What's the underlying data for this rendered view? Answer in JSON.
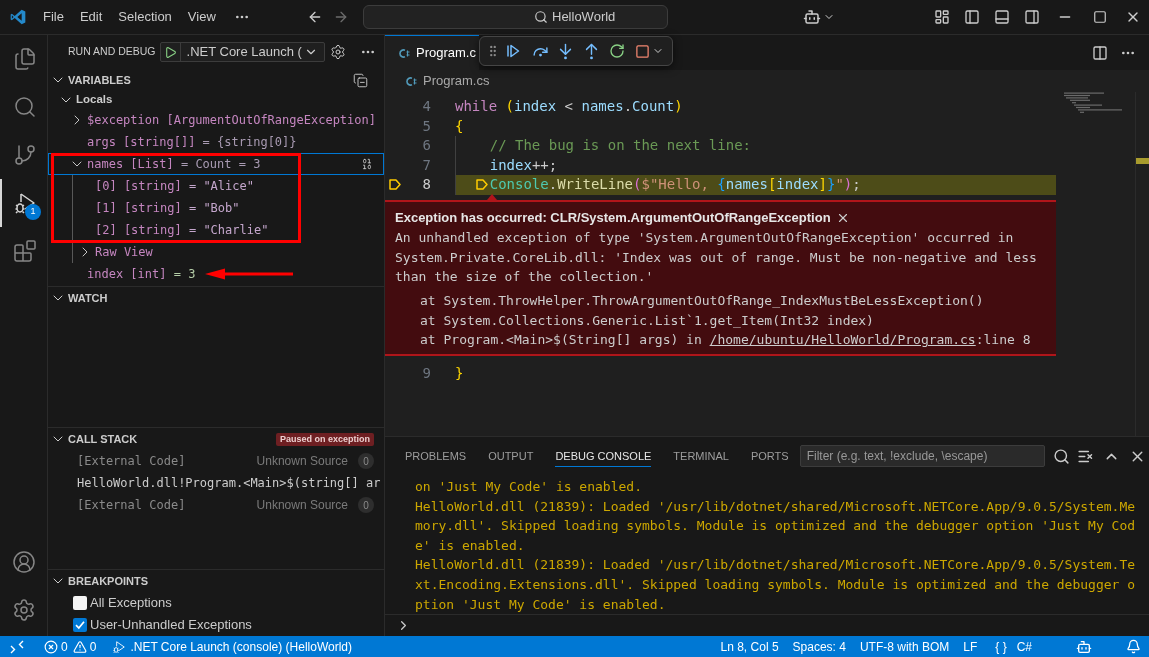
{
  "title_bar": {
    "menu": [
      {
        "label": "File"
      },
      {
        "label": "Edit"
      },
      {
        "label": "Selection"
      },
      {
        "label": "View"
      }
    ],
    "command_center": "HelloWorld"
  },
  "activity_bar": {
    "items": [
      {
        "kind": "explorer",
        "selected": false
      },
      {
        "kind": "search",
        "selected": false
      },
      {
        "kind": "source_control",
        "selected": false
      },
      {
        "kind": "run_debug",
        "selected": true,
        "badge": "1"
      },
      {
        "kind": "extensions",
        "selected": false
      }
    ],
    "bottom": [
      {
        "kind": "accounts"
      },
      {
        "kind": "manage"
      }
    ]
  },
  "sidebar": {
    "title": "RUN AND DEBUG",
    "launch_config": ".NET Core Launch (",
    "variables": {
      "title": "VARIABLES",
      "expanded": true,
      "scopes": [
        {
          "label": "Locals",
          "expanded": true,
          "children": [
            {
              "name": "$exception [ArgumentOutOfRangeException]",
              "expanded": false,
              "selected": false,
              "framed": false,
              "pointed": false
            },
            {
              "name": "args [string[]]",
              "value": "= {string[0]}",
              "kind": "plain",
              "selected": false,
              "framed": false,
              "pointed": false
            },
            {
              "name": "names [List]",
              "value": "= Count = 3",
              "kind": "plain",
              "expanded": true,
              "selected": true,
              "framed": true,
              "pointed": false,
              "children": [
                {
                  "name": "[0] [string]",
                  "value": "= \"Alice\"",
                  "kind": "string",
                  "selected": false,
                  "framed": false,
                  "pointed": false
                },
                {
                  "name": "[1] [string]",
                  "value": "= \"Bob\"",
                  "kind": "string",
                  "selected": false,
                  "framed": false,
                  "pointed": false
                },
                {
                  "name": "[2] [string]",
                  "value": "= \"Charlie\"",
                  "kind": "string",
                  "selected": false,
                  "framed": false,
                  "pointed": false
                },
                {
                  "name": "Raw View",
                  "expanded": false,
                  "selected": false,
                  "framed": false,
                  "pointed": false
                }
              ]
            },
            {
              "name": "index [int]",
              "value": "= 3",
              "kind": "number",
              "selected": false,
              "framed": false,
              "pointed": true
            }
          ]
        }
      ]
    },
    "watch": {
      "title": "WATCH",
      "expanded": true
    },
    "call_stack": {
      "title": "CALL STACK",
      "expanded": true,
      "badge": "Paused on exception",
      "frames": [
        {
          "kind": "external",
          "name": "[External Code]",
          "source": "Unknown Source",
          "count": "0"
        },
        {
          "kind": "frame",
          "name": "HelloWorld.dll!Program.<Main>$(string[] ar"
        },
        {
          "kind": "external",
          "name": "[External Code]",
          "source": "Unknown Source",
          "count": "0"
        }
      ]
    },
    "breakpoints": {
      "title": "BREAKPOINTS",
      "expanded": true,
      "items": [
        {
          "label": "All Exceptions",
          "checked": false
        },
        {
          "label": "User-Unhandled Exceptions",
          "checked": true
        }
      ]
    }
  },
  "editor": {
    "tabs": [
      {
        "label": "Program.c",
        "selected": true
      }
    ],
    "breadcrumb": "Program.cs",
    "lines": [
      {
        "number": "4",
        "current": false,
        "tokens": [
          {
            "text": "while",
            "kind": "keyword"
          },
          {
            "text": " (",
            "kind": "bracket1"
          },
          {
            "text": "index",
            "kind": "variable"
          },
          {
            "text": " < ",
            "kind": "plain"
          },
          {
            "text": "names",
            "kind": "variable"
          },
          {
            "text": ".",
            "kind": "plain"
          },
          {
            "text": "Count",
            "kind": "variable"
          },
          {
            "text": ")",
            "kind": "bracket1"
          }
        ]
      },
      {
        "number": "5",
        "current": false,
        "tokens": [
          {
            "text": "{",
            "kind": "bracket1"
          }
        ]
      },
      {
        "number": "6",
        "current": false,
        "tokens": [
          {
            "text": "    // The bug is on the next line:",
            "kind": "comment"
          }
        ]
      },
      {
        "number": "7",
        "current": false,
        "tokens": [
          {
            "text": "    index",
            "kind": "variable"
          },
          {
            "text": "++;",
            "kind": "plain"
          }
        ]
      },
      {
        "number": "8",
        "current": true,
        "tokens": [
          {
            "text": "    Console",
            "kind": "type"
          },
          {
            "text": ".",
            "kind": "plain"
          },
          {
            "text": "WriteLine",
            "kind": "method"
          },
          {
            "text": "(",
            "kind": "bracket2"
          },
          {
            "text": "$\"Hello, ",
            "kind": "string"
          },
          {
            "text": "{",
            "kind": "bracket3"
          },
          {
            "text": "names",
            "kind": "variable"
          },
          {
            "text": "[",
            "kind": "bracket1"
          },
          {
            "text": "index",
            "kind": "variable"
          },
          {
            "text": "]",
            "kind": "bracket1"
          },
          {
            "text": "}",
            "kind": "bracket3"
          },
          {
            "text": "\"",
            "kind": "string"
          },
          {
            "text": ")",
            "kind": "bracket2"
          },
          {
            "text": ";",
            "kind": "plain"
          }
        ]
      },
      {
        "number": "9",
        "current": false,
        "tokens": [
          {
            "text": "}",
            "kind": "bracket1"
          }
        ]
      }
    ],
    "exception": {
      "title": "Exception has occurred: CLR/System.ArgumentOutOfRangeException",
      "message": "An unhandled exception of type 'System.ArgumentOutOfRangeException' occurred in System.Private.CoreLib.dll: 'Index was out of range. Must be non-negative and less than the size of the collection.'",
      "stack": [
        {
          "text": "at System.ThrowHelper.ThrowArgumentOutOfRange_IndexMustBeLessException()"
        },
        {
          "text": "at System.Collections.Generic.List`1.get_Item(Int32 index)"
        },
        {
          "text": "at Program.<Main>$(String[] args) in ",
          "link": "/home/ubuntu/HelloWorld/Program.cs",
          "suffix": ":line 8"
        }
      ]
    }
  },
  "panel": {
    "tabs": [
      {
        "label": "PROBLEMS",
        "selected": false
      },
      {
        "label": "OUTPUT",
        "selected": false
      },
      {
        "label": "DEBUG CONSOLE",
        "selected": true
      },
      {
        "label": "TERMINAL",
        "selected": false
      },
      {
        "label": "PORTS",
        "selected": false
      }
    ],
    "filter_placeholder": "Filter (e.g. text, !exclude, \\escape)",
    "output": [
      "on 'Just My Code' is enabled.",
      "HelloWorld.dll (21839): Loaded '/usr/lib/dotnet/shared/Microsoft.NETCore.App/9.0.5/System.Memory.dll'. Skipped loading symbols. Module is optimized and the debugger option 'Just My Code' is enabled.",
      "HelloWorld.dll (21839): Loaded '/usr/lib/dotnet/shared/Microsoft.NETCore.App/9.0.5/System.Text.Encoding.Extensions.dll'. Skipped loading symbols. Module is optimized and the debugger option 'Just My Code' is enabled."
    ]
  },
  "status_bar": {
    "errors": "0",
    "warnings": "0",
    "launch": ".NET Core Launch (console) (HelloWorld)",
    "items": [
      "Ln 8, Col 5",
      "Spaces: 4",
      "UTF-8 with BOM",
      "LF"
    ],
    "language_status": "{ }",
    "language": "C#"
  }
}
